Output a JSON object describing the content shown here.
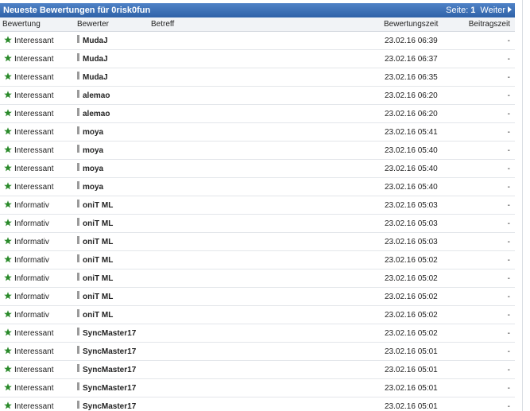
{
  "title_bar": {
    "title": "Neueste Bewertungen für 0risk0fun",
    "page_label": "Seite:",
    "page_number": "1",
    "next_label": "Weiter"
  },
  "columns": {
    "bewertung": "Bewertung",
    "bewerter": "Bewerter",
    "betreff": "Betreff",
    "zeit": "Bewertungszeit",
    "beitrag": "Beitragszeit"
  },
  "colors": {
    "title_bg": "#3a6db5",
    "star": "#2a8a2a"
  },
  "rows": [
    {
      "type": "Interessant",
      "user": "MudaJ",
      "time": "23.02.16 06:39",
      "beitrag": "-"
    },
    {
      "type": "Interessant",
      "user": "MudaJ",
      "time": "23.02.16 06:37",
      "beitrag": "-"
    },
    {
      "type": "Interessant",
      "user": "MudaJ",
      "time": "23.02.16 06:35",
      "beitrag": "-"
    },
    {
      "type": "Interessant",
      "user": "alemao",
      "time": "23.02.16 06:20",
      "beitrag": "-"
    },
    {
      "type": "Interessant",
      "user": "alemao",
      "time": "23.02.16 06:20",
      "beitrag": "-"
    },
    {
      "type": "Interessant",
      "user": "moya",
      "time": "23.02.16 05:41",
      "beitrag": "-"
    },
    {
      "type": "Interessant",
      "user": "moya",
      "time": "23.02.16 05:40",
      "beitrag": "-"
    },
    {
      "type": "Interessant",
      "user": "moya",
      "time": "23.02.16 05:40",
      "beitrag": "-"
    },
    {
      "type": "Interessant",
      "user": "moya",
      "time": "23.02.16 05:40",
      "beitrag": "-"
    },
    {
      "type": "Informativ",
      "user": "oniT ML",
      "time": "23.02.16 05:03",
      "beitrag": "-"
    },
    {
      "type": "Informativ",
      "user": "oniT ML",
      "time": "23.02.16 05:03",
      "beitrag": "-"
    },
    {
      "type": "Informativ",
      "user": "oniT ML",
      "time": "23.02.16 05:03",
      "beitrag": "-"
    },
    {
      "type": "Informativ",
      "user": "oniT ML",
      "time": "23.02.16 05:02",
      "beitrag": "-"
    },
    {
      "type": "Informativ",
      "user": "oniT ML",
      "time": "23.02.16 05:02",
      "beitrag": "-"
    },
    {
      "type": "Informativ",
      "user": "oniT ML",
      "time": "23.02.16 05:02",
      "beitrag": "-"
    },
    {
      "type": "Informativ",
      "user": "oniT ML",
      "time": "23.02.16 05:02",
      "beitrag": "-"
    },
    {
      "type": "Interessant",
      "user": "SyncMaster17",
      "time": "23.02.16 05:02",
      "beitrag": "-"
    },
    {
      "type": "Interessant",
      "user": "SyncMaster17",
      "time": "23.02.16 05:01",
      "beitrag": "-"
    },
    {
      "type": "Interessant",
      "user": "SyncMaster17",
      "time": "23.02.16 05:01",
      "beitrag": "-"
    },
    {
      "type": "Interessant",
      "user": "SyncMaster17",
      "time": "23.02.16 05:01",
      "beitrag": "-"
    },
    {
      "type": "Interessant",
      "user": "SyncMaster17",
      "time": "23.02.16 05:01",
      "beitrag": "-"
    }
  ]
}
